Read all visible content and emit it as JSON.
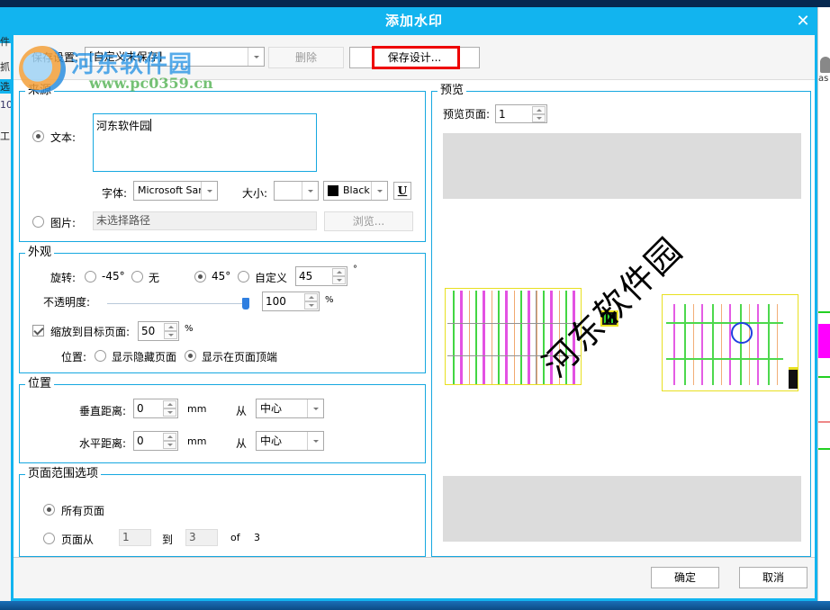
{
  "dialog": {
    "title": "添加水印",
    "close_icon": "close-icon"
  },
  "overlay_logo": {
    "name": "河东软件园",
    "url": "www.pc0359.cn"
  },
  "background_app": {
    "left_labels": [
      "件",
      "抓",
      "选",
      "10",
      "工"
    ],
    "right_label": "as"
  },
  "toolbar": {
    "save_settings_label": "保存设置:",
    "save_settings_value": "[自定义未保存]",
    "delete_label": "删除",
    "save_design_label": "保存设计..."
  },
  "source": {
    "title": "来源",
    "text_label": "文本:",
    "text_value": "河东软件园",
    "text_selected": true,
    "font_label": "字体:",
    "font_value": "Microsoft Sans",
    "size_label": "大小:",
    "size_value": "",
    "color_value": "Black",
    "color_hex": "#000000",
    "underline_label": "U",
    "image_label": "图片:",
    "image_selected": false,
    "image_path_placeholder": "未选择路径",
    "browse_label": "浏览..."
  },
  "appearance": {
    "title": "外观",
    "rotation_label": "旋转:",
    "rotation_options": [
      {
        "label": "-45°",
        "selected": false
      },
      {
        "label": "无",
        "selected": false
      },
      {
        "label": "45°",
        "selected": true
      },
      {
        "label": "自定义",
        "selected": false
      }
    ],
    "custom_rotation_value": "45",
    "degree_unit": "°",
    "opacity_label": "不透明度:",
    "opacity_value": "100",
    "opacity_fraction": 1.0,
    "percent_unit": "%",
    "scale_label": "缩放到目标页面:",
    "scale_checked": true,
    "scale_value": "50",
    "position_label": "位置:",
    "position_options": [
      {
        "label": "显示隐藏页面",
        "selected": false
      },
      {
        "label": "显示在页面顶端",
        "selected": true
      }
    ]
  },
  "position": {
    "title": "位置",
    "vertical_label": "垂直距离:",
    "vertical_value": "0",
    "horizontal_label": "水平距离:",
    "horizontal_value": "0",
    "unit": "mm",
    "from_label": "从",
    "vertical_from": "中心",
    "horizontal_from": "中心"
  },
  "page_range": {
    "title": "页面范围选项",
    "all_pages_label": "所有页面",
    "all_pages_selected": true,
    "pages_from_label": "页面从",
    "pages_from_selected": false,
    "from_value": "1",
    "to_label": "到",
    "to_value": "3",
    "of_label": "of",
    "total_pages": "3"
  },
  "preview": {
    "title": "预览",
    "page_label": "预览页面:",
    "page_value": "1",
    "watermark_text": "河东软件园"
  },
  "footer": {
    "ok_label": "确定",
    "cancel_label": "取消"
  }
}
